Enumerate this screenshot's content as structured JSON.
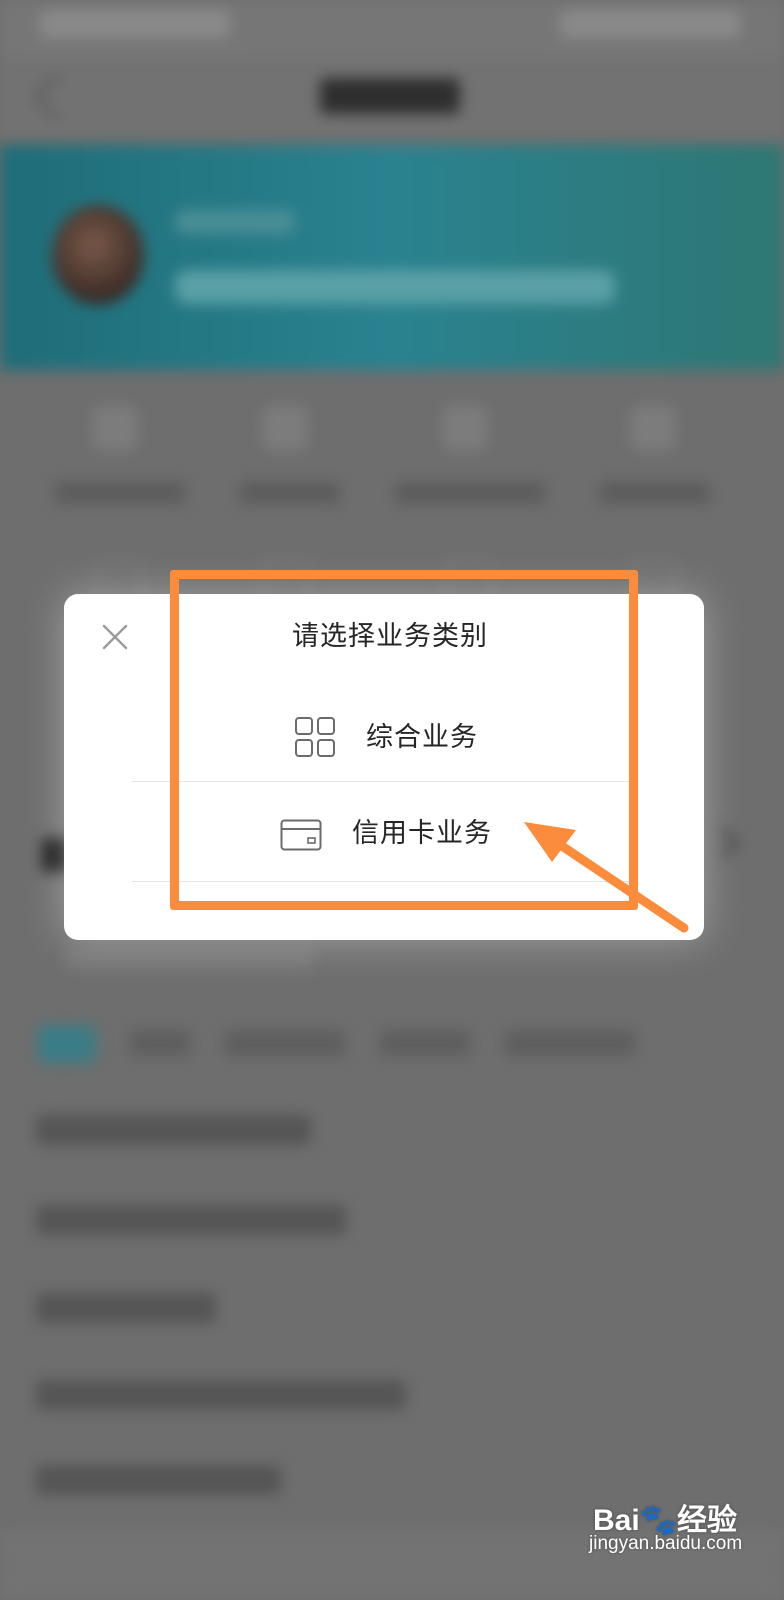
{
  "dialog": {
    "title": "请选择业务类别",
    "options": [
      {
        "label": "综合业务",
        "icon": "grid-icon"
      },
      {
        "label": "信用卡业务",
        "icon": "credit-card-icon"
      }
    ],
    "close_icon": "close-icon"
  },
  "annotation": {
    "color": "#fb8c3c"
  },
  "watermark": {
    "logo": "Bai🐾经验",
    "url": "jingyan.baidu.com"
  },
  "background_app": {
    "banner_color": "#2a8290",
    "overlay_color": "#6e6e6e"
  }
}
